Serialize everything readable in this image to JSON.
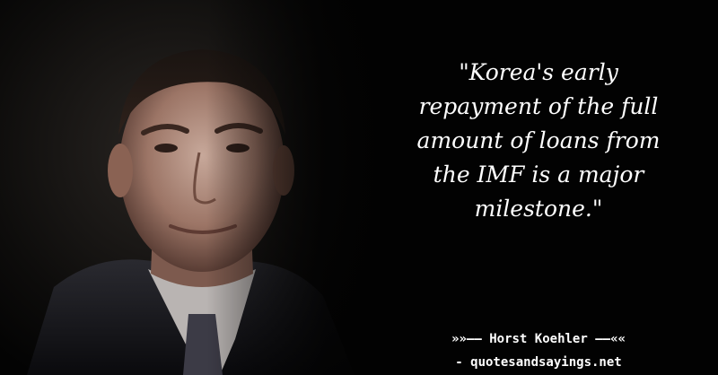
{
  "quote": {
    "lines": [
      "\"Korea's early",
      "repayment of the full",
      "amount of loans from",
      "the IMF is a major",
      "milestone.\""
    ]
  },
  "attribution": {
    "author_line": "»»–– Horst Koehler ––««",
    "source_line": "- quotesandsayings.net"
  },
  "colors": {
    "background": "#020202",
    "text": "#ffffff"
  }
}
